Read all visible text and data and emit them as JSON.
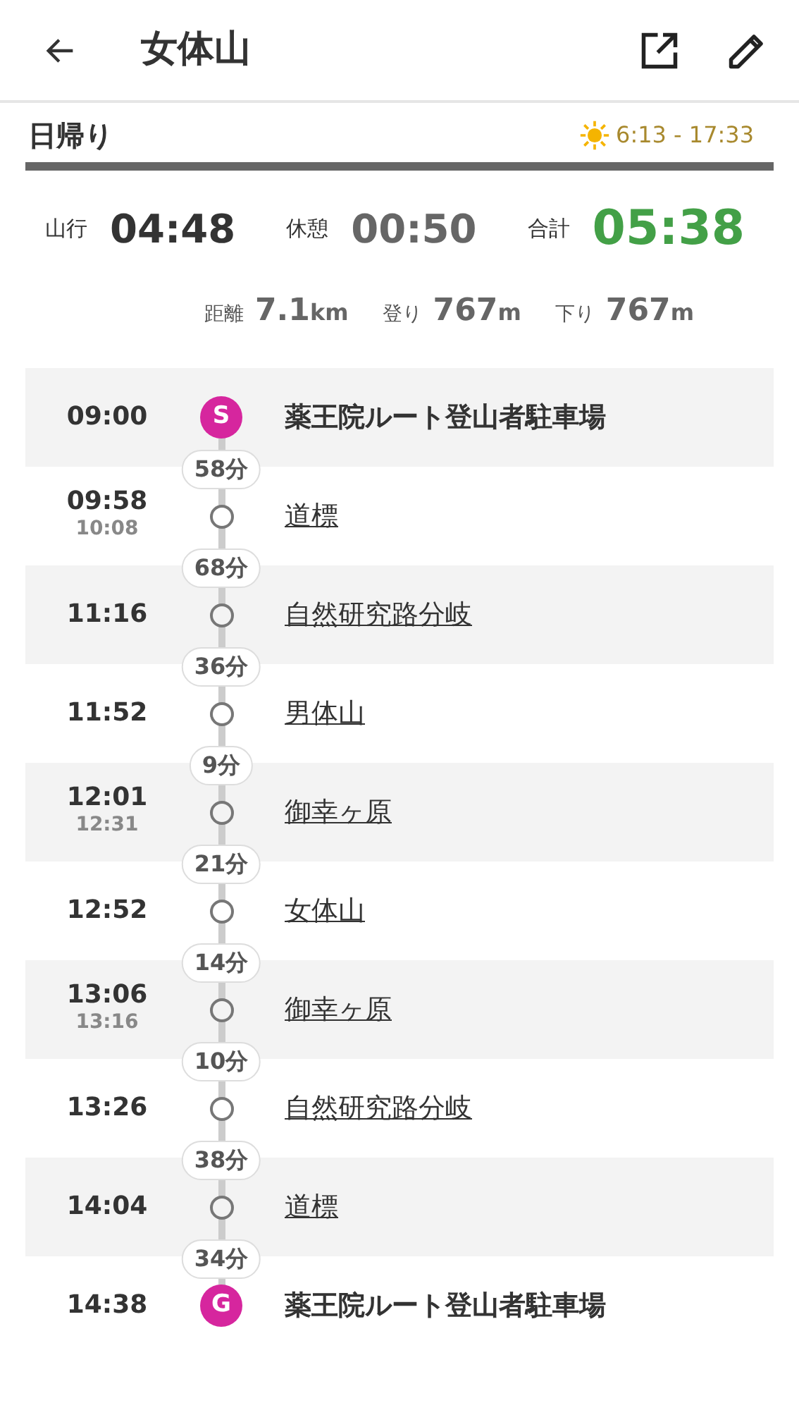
{
  "header": {
    "title": "女体山"
  },
  "plan": {
    "type": "日帰り",
    "daylight": "6:13 - 17:33"
  },
  "times": [
    {
      "kind": "moving",
      "label": "山行",
      "value": "04:48"
    },
    {
      "kind": "rest",
      "label": "休憩",
      "value": "00:50"
    },
    {
      "kind": "total",
      "label": "合計",
      "value": "05:38"
    }
  ],
  "distances": [
    {
      "label": "距離",
      "value": "7.1",
      "unit": "km"
    },
    {
      "label": "登り",
      "value": "767",
      "unit": "m"
    },
    {
      "label": "下り",
      "value": "767",
      "unit": "m"
    }
  ],
  "stops": [
    {
      "kind": "start",
      "marker": "S",
      "arrival": "09:00",
      "name": "薬王院ルート登山者駐車場",
      "leg": "58分"
    },
    {
      "kind": "waypoint",
      "arrival": "09:58",
      "departure": "10:08",
      "name": "道標",
      "leg": "68分"
    },
    {
      "kind": "waypoint",
      "arrival": "11:16",
      "name": "自然研究路分岐",
      "leg": "36分"
    },
    {
      "kind": "waypoint",
      "arrival": "11:52",
      "name": "男体山",
      "leg": "9分"
    },
    {
      "kind": "waypoint",
      "arrival": "12:01",
      "departure": "12:31",
      "name": "御幸ヶ原",
      "leg": "21分"
    },
    {
      "kind": "waypoint",
      "arrival": "12:52",
      "name": "女体山",
      "leg": "14分"
    },
    {
      "kind": "waypoint",
      "arrival": "13:06",
      "departure": "13:16",
      "name": "御幸ヶ原",
      "leg": "10分"
    },
    {
      "kind": "waypoint",
      "arrival": "13:26",
      "name": "自然研究路分岐",
      "leg": "38分"
    },
    {
      "kind": "waypoint",
      "arrival": "14:04",
      "name": "道標",
      "leg": "34分"
    },
    {
      "kind": "goal",
      "marker": "G",
      "arrival": "14:38",
      "name": "薬王院ルート登山者駐車場"
    }
  ]
}
